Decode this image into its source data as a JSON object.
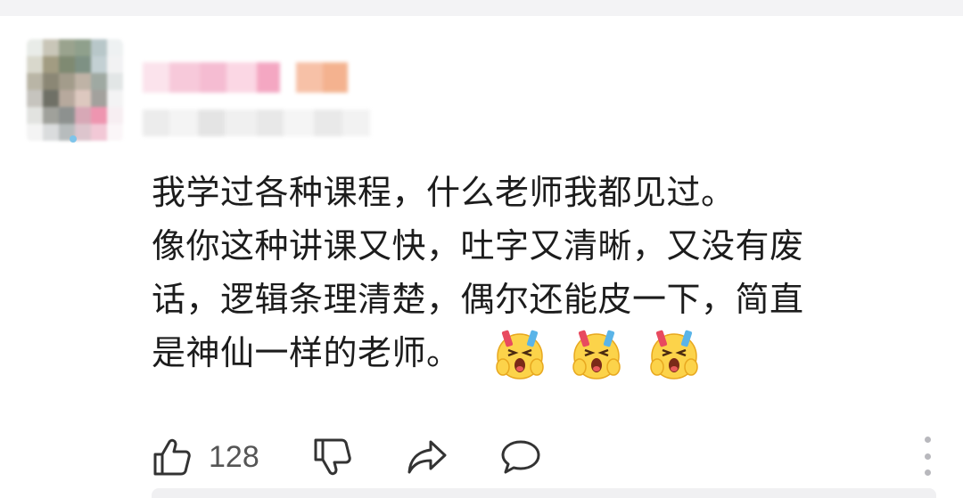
{
  "comment": {
    "text_lines": [
      "我学过各种课程，什么老师我都见过。",
      "像你这种讲课又快，吐字又清晰，又没有废",
      "话，逻辑条理清楚，偶尔还能皮一下，简直",
      "是神仙一样的老师。"
    ],
    "emoji_count": 3
  },
  "actions": {
    "like_count": "128"
  },
  "icons": {
    "like": "thumbs-up-icon",
    "dislike": "thumbs-down-icon",
    "share": "share-icon",
    "reply": "comment-bubble-icon",
    "more": "more-vertical-icon"
  },
  "colors": {
    "text": "#1c1c1c",
    "icon": "#333333",
    "more_dots": "#b8b8bd"
  }
}
